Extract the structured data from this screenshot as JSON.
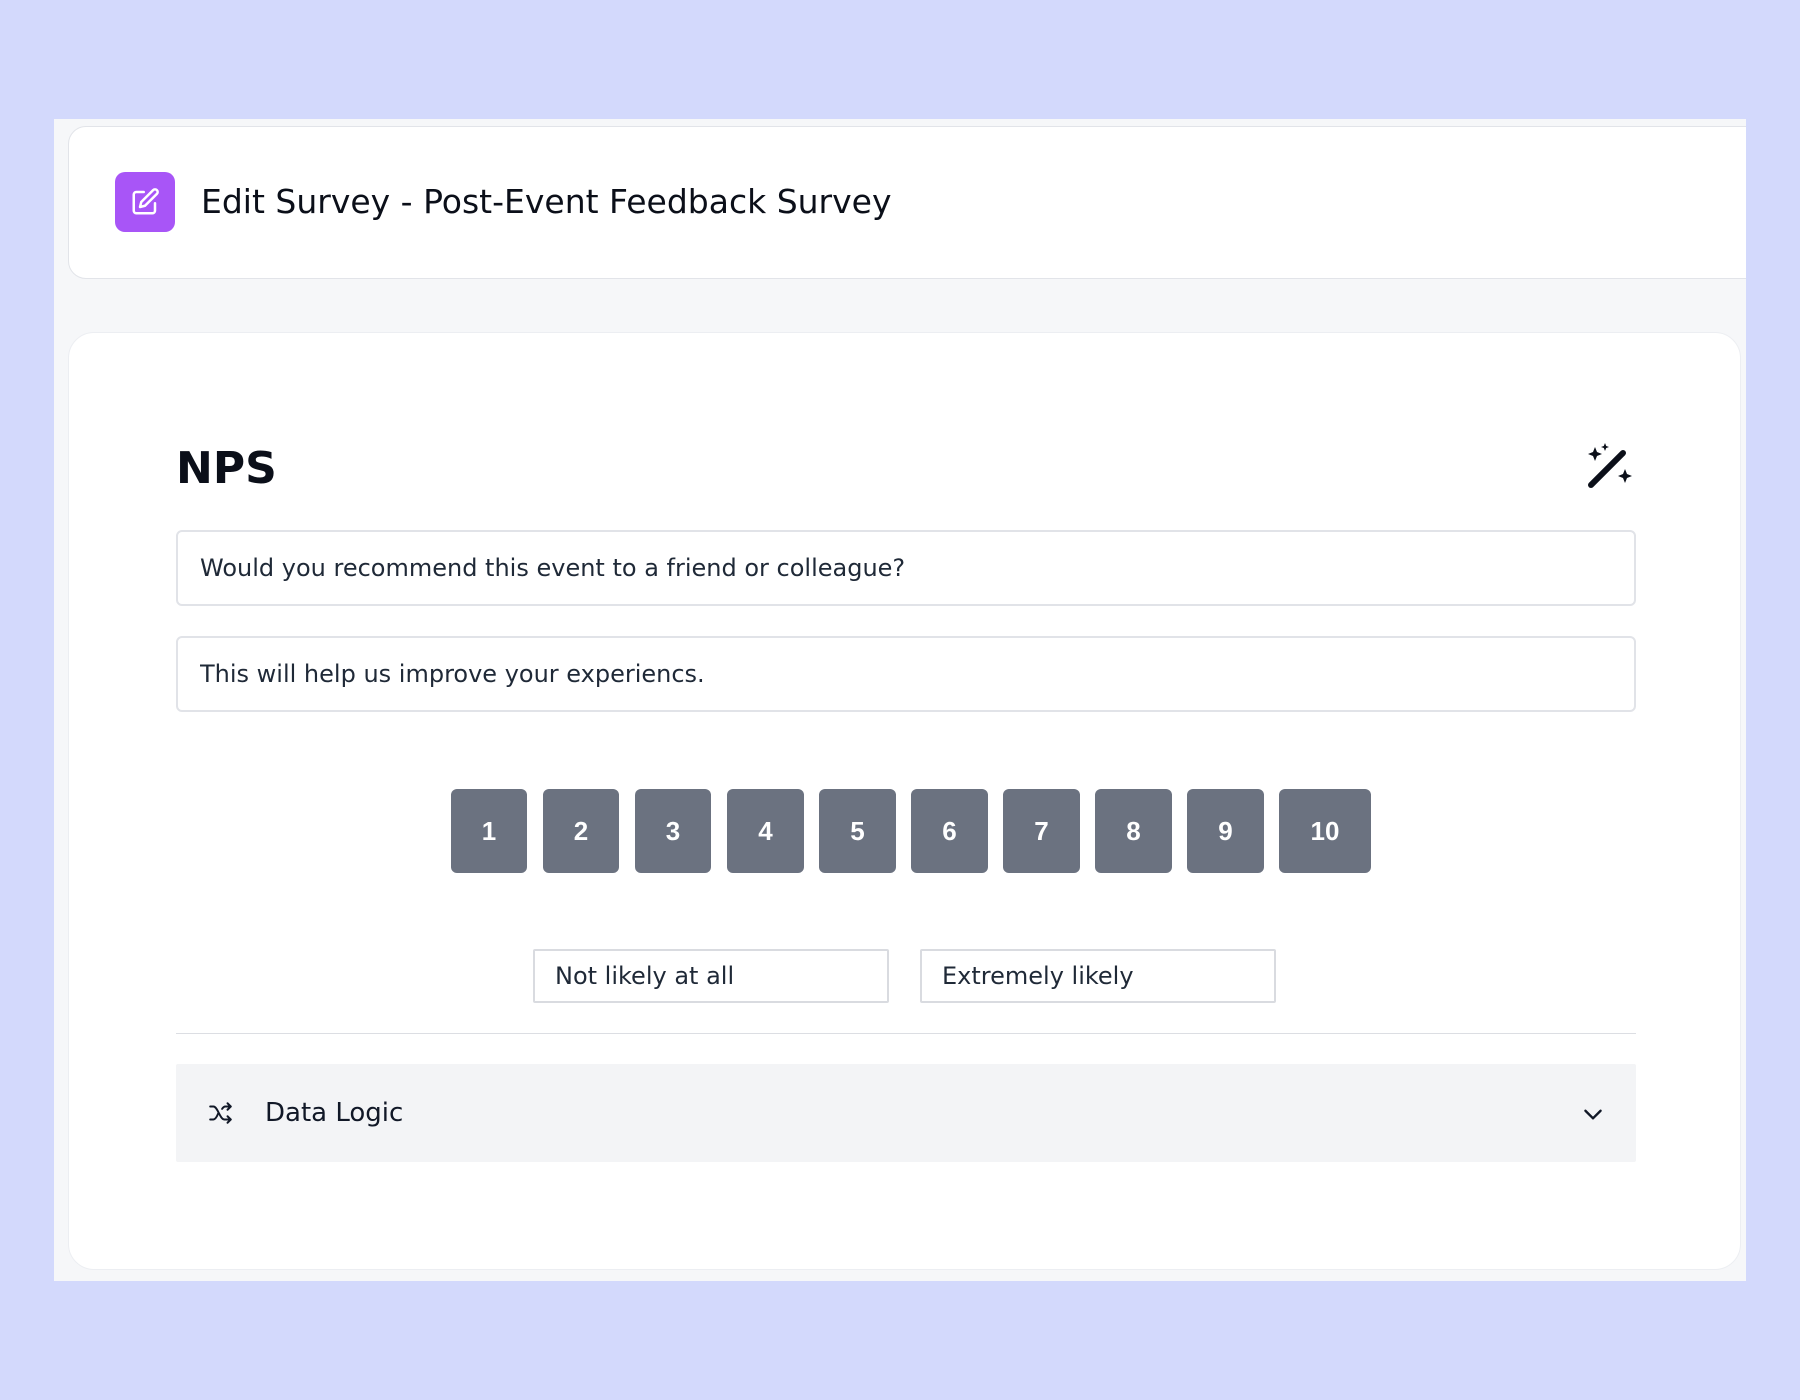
{
  "colors": {
    "page_background": "#d3d9fc",
    "accent": "#a855f7",
    "scale_button": "#6b7280",
    "panel": "#f3f4f6"
  },
  "header": {
    "icon": "edit-icon",
    "title": "Edit Survey - Post-Event Feedback Survey"
  },
  "question": {
    "type": "NPS",
    "ai_icon": "magic-wand-icon",
    "question_text": "Would you recommend this event to a friend or colleague?",
    "subtitle_text": "This will help us improve your experiencs."
  },
  "scale": {
    "options": [
      "1",
      "2",
      "3",
      "4",
      "5",
      "6",
      "7",
      "8",
      "9",
      "10"
    ],
    "low_label": "Not likely at all",
    "high_label": "Extremely likely"
  },
  "data_logic": {
    "label": "Data Logic",
    "icon": "shuffle-icon",
    "toggle_icon": "chevron-down-icon"
  }
}
